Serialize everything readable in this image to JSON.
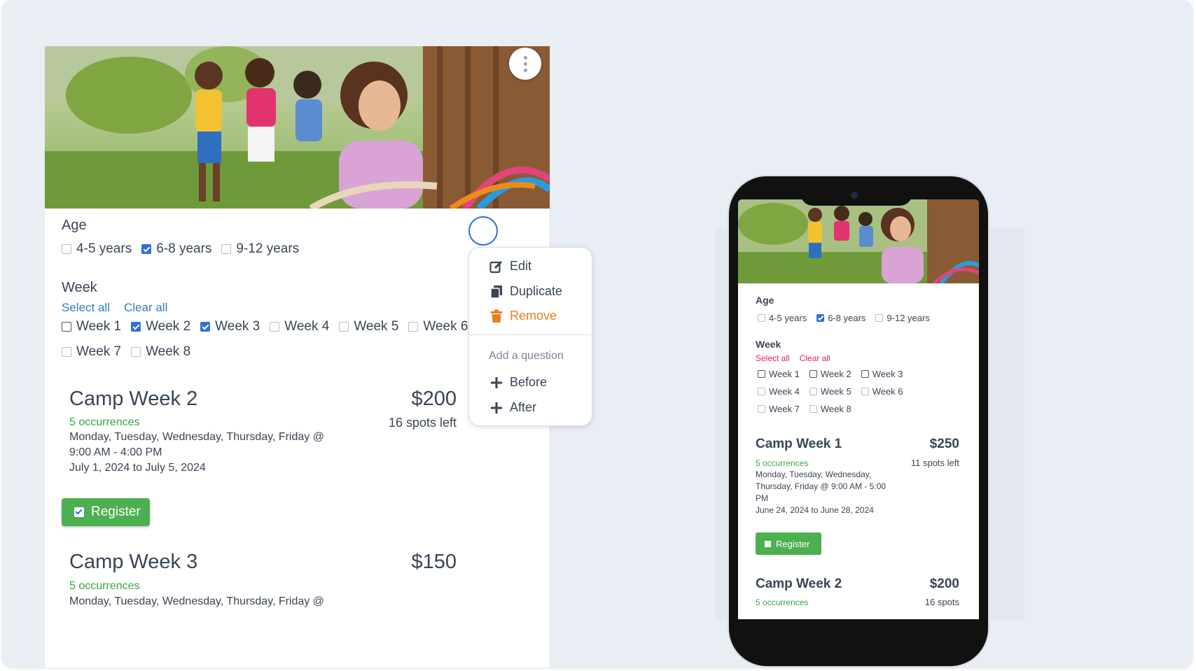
{
  "desktop": {
    "age": {
      "label": "Age",
      "options": [
        {
          "label": "4-5 years",
          "checked": false
        },
        {
          "label": "6-8 years",
          "checked": true
        },
        {
          "label": "9-12 years",
          "checked": false
        }
      ]
    },
    "week": {
      "label": "Week",
      "select_all": "Select all",
      "clear_all": "Clear all",
      "options": [
        {
          "label": "Week 1",
          "checked": false
        },
        {
          "label": "Week 2",
          "checked": true
        },
        {
          "label": "Week 3",
          "checked": true
        },
        {
          "label": "Week 4",
          "checked": false
        },
        {
          "label": "Week 5",
          "checked": false
        },
        {
          "label": "Week 6",
          "checked": false
        },
        {
          "label": "Week 7",
          "checked": false
        },
        {
          "label": "Week 8",
          "checked": false
        }
      ]
    },
    "camps": [
      {
        "title": "Camp Week 2",
        "price": "$200",
        "occurrences": "5 occurrences",
        "spots": "16 spots left",
        "schedule_line1": "Monday, Tuesday, Wednesday, Thursday, Friday @",
        "schedule_line2": "9:00 AM - 4:00 PM",
        "dates": "July 1, 2024 to July 5, 2024",
        "register_label": "Register",
        "register_checked": true
      },
      {
        "title": "Camp Week 3",
        "price": "$150",
        "occurrences": "5 occurrences",
        "schedule_line1": "Monday, Tuesday, Wednesday, Thursday, Friday @"
      }
    ]
  },
  "menu": {
    "edit": "Edit",
    "duplicate": "Duplicate",
    "remove": "Remove",
    "add_question": "Add a question",
    "before": "Before",
    "after": "After"
  },
  "phone": {
    "age": {
      "label": "Age",
      "options": [
        {
          "label": "4-5 years",
          "checked": false
        },
        {
          "label": "6-8 years",
          "checked": true
        },
        {
          "label": "9-12 years",
          "checked": false
        }
      ]
    },
    "week": {
      "label": "Week",
      "select_all": "Select all",
      "clear_all": "Clear all",
      "options": [
        "Week 1",
        "Week 2",
        "Week 3",
        "Week 4",
        "Week 5",
        "Week 6",
        "Week 7",
        "Week 8"
      ]
    },
    "camps": [
      {
        "title": "Camp Week 1",
        "price": "$250",
        "occurrences": "5 occurrences",
        "spots": "11 spots left",
        "schedule_line1": "Monday, Tuesday, Wednesday,",
        "schedule_line2": "Thursday, Friday @ 9:00 AM - 5:00",
        "schedule_line3": "PM",
        "dates": "June 24, 2024 to June 28, 2024",
        "register_label": "Register"
      },
      {
        "title": "Camp Week 2",
        "price": "$200",
        "occurrences": "5 occurrences",
        "spots": "16 spots"
      }
    ]
  },
  "colors": {
    "accent_blue": "#2f6fe0",
    "link_blue": "#2f7fbf",
    "green": "#4caf50",
    "remove_orange": "#e67e22",
    "phone_link_pink": "#e0245e"
  }
}
